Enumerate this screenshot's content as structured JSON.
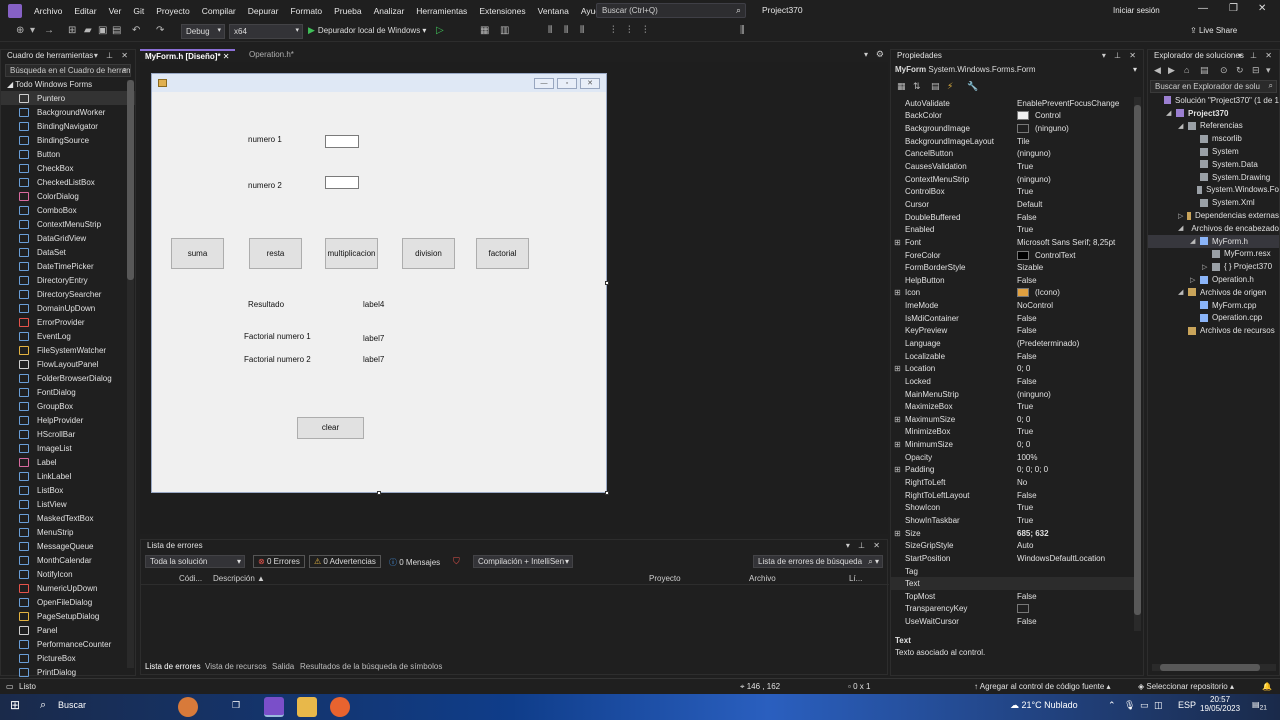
{
  "menubar": {
    "items": [
      "Archivo",
      "Editar",
      "Ver",
      "Git",
      "Proyecto",
      "Compilar",
      "Depurar",
      "Formato",
      "Prueba",
      "Analizar",
      "Herramientas",
      "Extensiones",
      "Ventana",
      "Ayuda"
    ],
    "search_placeholder": "Buscar (Ctrl+Q)",
    "project": "Project370",
    "signin": "Iniciar sesión"
  },
  "toolbar": {
    "config": "Debug",
    "platform": "x64",
    "run_label": "Depurador local de Windows",
    "liveshare": "Live Share"
  },
  "toolbox": {
    "title": "Cuadro de herramientas",
    "search": "Búsqueda en el Cuadro de herramientas",
    "group": "Todo Windows Forms",
    "items": [
      "Puntero",
      "BackgroundWorker",
      "BindingNavigator",
      "BindingSource",
      "Button",
      "CheckBox",
      "CheckedListBox",
      "ColorDialog",
      "ComboBox",
      "ContextMenuStrip",
      "DataGridView",
      "DataSet",
      "DateTimePicker",
      "DirectoryEntry",
      "DirectorySearcher",
      "DomainUpDown",
      "ErrorProvider",
      "EventLog",
      "FileSystemWatcher",
      "FlowLayoutPanel",
      "FolderBrowserDialog",
      "FontDialog",
      "GroupBox",
      "HelpProvider",
      "HScrollBar",
      "ImageList",
      "Label",
      "LinkLabel",
      "ListBox",
      "ListView",
      "MaskedTextBox",
      "MenuStrip",
      "MessageQueue",
      "MonthCalendar",
      "NotifyIcon",
      "NumericUpDown",
      "OpenFileDialog",
      "PageSetupDialog",
      "Panel",
      "PerformanceCounter",
      "PictureBox",
      "PrintDialog"
    ]
  },
  "tabs": {
    "active": "MyForm.h [Diseño]*",
    "inactive": "Operation.h*"
  },
  "form": {
    "label_numero1": "numero 1",
    "label_numero2": "numero 2",
    "btn_suma": "suma",
    "btn_resta": "resta",
    "btn_multiplicacion": "multiplicacion",
    "btn_division": "division",
    "btn_factorial": "factorial",
    "label_resultado": "Resultado",
    "label4": "label4",
    "label_fact1": "Factorial numero 1",
    "label7a": "label7",
    "label_fact2": "Factorial numero 2",
    "label7b": "label7",
    "btn_clear": "clear"
  },
  "errors": {
    "title": "Lista de errores",
    "scope": "Toda la solución",
    "errors": "0 Errores",
    "warnings": "0 Advertencias",
    "messages": "0 Mensajes",
    "build": "Compilación + IntelliSen",
    "search": "Lista de errores de búsqueda",
    "columns": [
      "Códi...",
      "Descripción",
      "Proyecto",
      "Archivo",
      "Lí..."
    ],
    "bottom_tabs": [
      "Lista de errores",
      "Vista de recursos",
      "Salida",
      "Resultados de la búsqueda de símbolos"
    ]
  },
  "properties": {
    "title": "Propiedades",
    "object_name": "MyForm",
    "object_type": "System.Windows.Forms.Form",
    "rows": [
      {
        "name": "AutoValidate",
        "value": "EnablePreventFocusChange"
      },
      {
        "name": "BackColor",
        "value": "Control",
        "swatch": "#f0f0f0"
      },
      {
        "name": "BackgroundImage",
        "value": "(ninguno)",
        "swatch": "#1f1f1f"
      },
      {
        "name": "BackgroundImageLayout",
        "value": "Tile"
      },
      {
        "name": "CancelButton",
        "value": "(ninguno)"
      },
      {
        "name": "CausesValidation",
        "value": "True"
      },
      {
        "name": "ContextMenuStrip",
        "value": "(ninguno)"
      },
      {
        "name": "ControlBox",
        "value": "True"
      },
      {
        "name": "Cursor",
        "value": "Default"
      },
      {
        "name": "DoubleBuffered",
        "value": "False"
      },
      {
        "name": "Enabled",
        "value": "True"
      },
      {
        "name": "Font",
        "value": "Microsoft Sans Serif; 8,25pt",
        "expand": true
      },
      {
        "name": "ForeColor",
        "value": "ControlText",
        "swatch": "#000000"
      },
      {
        "name": "FormBorderStyle",
        "value": "Sizable"
      },
      {
        "name": "HelpButton",
        "value": "False"
      },
      {
        "name": "Icon",
        "value": "(Icono)",
        "expand": true,
        "swatch": "#e0a040"
      },
      {
        "name": "ImeMode",
        "value": "NoControl"
      },
      {
        "name": "IsMdiContainer",
        "value": "False"
      },
      {
        "name": "KeyPreview",
        "value": "False"
      },
      {
        "name": "Language",
        "value": "(Predeterminado)"
      },
      {
        "name": "Localizable",
        "value": "False"
      },
      {
        "name": "Location",
        "value": "0; 0",
        "expand": true
      },
      {
        "name": "Locked",
        "value": "False"
      },
      {
        "name": "MainMenuStrip",
        "value": "(ninguno)"
      },
      {
        "name": "MaximizeBox",
        "value": "True"
      },
      {
        "name": "MaximumSize",
        "value": "0; 0",
        "expand": true
      },
      {
        "name": "MinimizeBox",
        "value": "True"
      },
      {
        "name": "MinimumSize",
        "value": "0; 0",
        "expand": true
      },
      {
        "name": "Opacity",
        "value": "100%"
      },
      {
        "name": "Padding",
        "value": "0; 0; 0; 0",
        "expand": true
      },
      {
        "name": "RightToLeft",
        "value": "No"
      },
      {
        "name": "RightToLeftLayout",
        "value": "False"
      },
      {
        "name": "ShowIcon",
        "value": "True"
      },
      {
        "name": "ShowInTaskbar",
        "value": "True"
      },
      {
        "name": "Size",
        "value": "685; 632",
        "expand": true,
        "bold": true
      },
      {
        "name": "SizeGripStyle",
        "value": "Auto"
      },
      {
        "name": "StartPosition",
        "value": "WindowsDefaultLocation"
      },
      {
        "name": "Tag",
        "value": ""
      },
      {
        "name": "Text",
        "value": "",
        "selected": true
      },
      {
        "name": "TopMost",
        "value": "False"
      },
      {
        "name": "TransparencyKey",
        "value": "",
        "swatch": "#1f1f1f"
      },
      {
        "name": "UseWaitCursor",
        "value": "False"
      }
    ],
    "desc_title": "Text",
    "desc_text": "Texto asociado al control."
  },
  "solution": {
    "title": "Explorador de soluciones",
    "search": "Buscar en Explorador de solu",
    "items": [
      {
        "label": "Solución \"Project370\" (1 de 1",
        "level": 0,
        "arrow": "",
        "color": "#9b7fd1"
      },
      {
        "label": "Project370",
        "level": 1,
        "arrow": "◢",
        "color": "#9b7fd1",
        "bold": true
      },
      {
        "label": "Referencias",
        "level": 2,
        "arrow": "◢",
        "color": "#9aa0a6"
      },
      {
        "label": "mscorlib",
        "level": 3,
        "arrow": "",
        "color": "#9aa0a6"
      },
      {
        "label": "System",
        "level": 3,
        "arrow": "",
        "color": "#9aa0a6"
      },
      {
        "label": "System.Data",
        "level": 3,
        "arrow": "",
        "color": "#9aa0a6"
      },
      {
        "label": "System.Drawing",
        "level": 3,
        "arrow": "",
        "color": "#9aa0a6"
      },
      {
        "label": "System.Windows.Fo",
        "level": 3,
        "arrow": "",
        "color": "#9aa0a6"
      },
      {
        "label": "System.Xml",
        "level": 3,
        "arrow": "",
        "color": "#9aa0a6"
      },
      {
        "label": "Dependencias externas",
        "level": 2,
        "arrow": "▷",
        "color": "#c9a45a"
      },
      {
        "label": "Archivos de encabezado",
        "level": 2,
        "arrow": "◢",
        "color": "#c9a45a"
      },
      {
        "label": "MyForm.h",
        "level": 3,
        "arrow": "◢",
        "color": "#8ab4f8",
        "selected": true
      },
      {
        "label": "MyForm.resx",
        "level": 4,
        "arrow": "",
        "color": "#9aa0a6"
      },
      {
        "label": "{ } Project370",
        "level": 4,
        "arrow": "▷",
        "color": "#9aa0a6"
      },
      {
        "label": "Operation.h",
        "level": 3,
        "arrow": "▷",
        "color": "#8ab4f8"
      },
      {
        "label": "Archivos de origen",
        "level": 2,
        "arrow": "◢",
        "color": "#c9a45a"
      },
      {
        "label": "MyForm.cpp",
        "level": 3,
        "arrow": "",
        "color": "#8ab4f8"
      },
      {
        "label": "Operation.cpp",
        "level": 3,
        "arrow": "",
        "color": "#8ab4f8"
      },
      {
        "label": "Archivos de recursos",
        "level": 2,
        "arrow": "",
        "color": "#c9a45a"
      }
    ]
  },
  "status": {
    "ready": "Listo",
    "coords": "146 , 162",
    "size": "0 x 1",
    "source_control": "Agregar al control de código fuente",
    "repo": "Seleccionar repositorio",
    "badge": "1"
  },
  "taskbar": {
    "search": "Buscar",
    "weather": "21°C  Nublado",
    "lang": "ESP",
    "time": "20:57",
    "date": "19/05/2023",
    "notif": "21"
  }
}
